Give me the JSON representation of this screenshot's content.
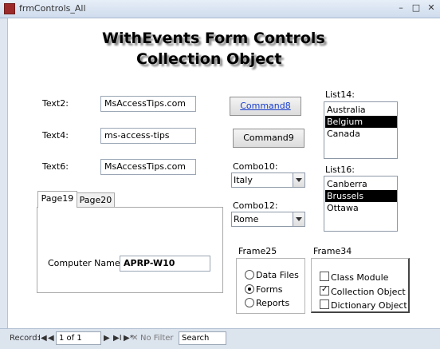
{
  "window": {
    "title": "frmControls_All",
    "min": "–",
    "max": "□",
    "close": "✕"
  },
  "heading": {
    "line1": "WithEvents Form Controls",
    "line2": "Collection Object"
  },
  "textboxes": [
    {
      "label": "Text2:",
      "value": "MsAccessTips.com"
    },
    {
      "label": "Text4:",
      "value": "ms-access-tips"
    },
    {
      "label": "Text6:",
      "value": "MsAccessTips.com"
    }
  ],
  "buttons": {
    "command8": "Command8",
    "command9": "Command9"
  },
  "combos": [
    {
      "label": "Combo10:",
      "value": "Italy"
    },
    {
      "label": "Combo12:",
      "value": "Rome"
    }
  ],
  "list14": {
    "label": "List14:",
    "items": [
      "Australia",
      "Belgium",
      "Canada"
    ],
    "selected": "Belgium"
  },
  "list16": {
    "label": "List16:",
    "items": [
      "Canberra",
      "Brussels",
      "Ottawa"
    ],
    "selected": "Brussels"
  },
  "tabs": {
    "items": [
      "Page19",
      "Page20"
    ],
    "active": "Page19",
    "page19": {
      "label": "Computer Name:",
      "value": "APRP-W10"
    }
  },
  "frame25": {
    "label": "Frame25",
    "options": [
      "Data Files",
      "Forms",
      "Reports"
    ],
    "selected": "Forms"
  },
  "frame34": {
    "label": "Frame34",
    "options": [
      {
        "text": "Class Module",
        "checked": false
      },
      {
        "text": "Collection Object",
        "checked": true
      },
      {
        "text": "Dictionary Object",
        "checked": false
      }
    ]
  },
  "navigation": {
    "record_label": "Record:",
    "position": "1 of 1",
    "filter": "No Filter",
    "search": "Search",
    "first": "I◀",
    "prev": "◀",
    "next": "▶",
    "last": "▶I",
    "new": "▶*"
  }
}
